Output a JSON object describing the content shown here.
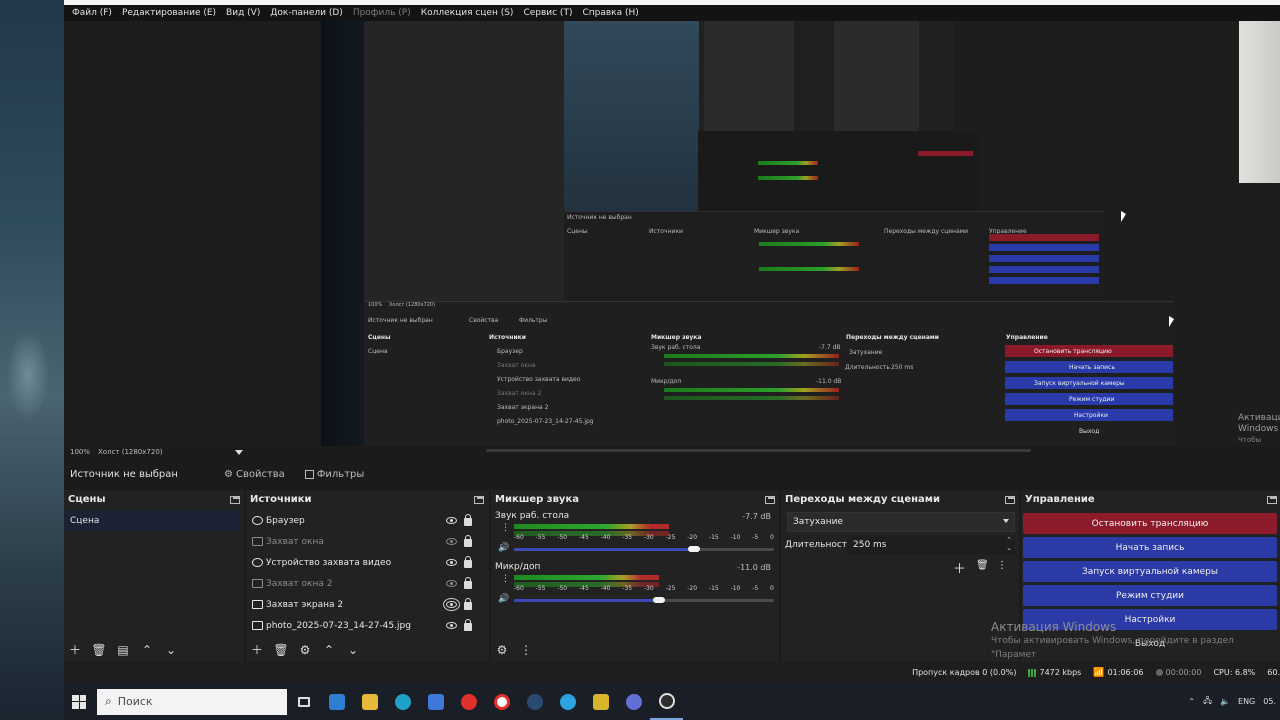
{
  "menu": {
    "items": [
      {
        "label": "Файл (F)"
      },
      {
        "label": "Редактирование (E)"
      },
      {
        "label": "Вид (V)"
      },
      {
        "label": "Док-панели (D)"
      },
      {
        "label": "Профиль (P)"
      },
      {
        "label": "Коллекция сцен (S)"
      },
      {
        "label": "Сервис (T)"
      },
      {
        "label": "Справка (H)"
      }
    ]
  },
  "preview": {
    "zoom": "100%",
    "canvas_label": "Холст (1280x720)",
    "nested": {
      "source_not_selected": "Источник не выбран",
      "properties": "Свойства",
      "filters": "Фильтры",
      "scenes": "Сцены",
      "scene": "Сцена",
      "sources": "Источники",
      "src1": "Браузер",
      "src2": "Захват окна",
      "src3": "Устройство захвата видео",
      "src4": "Захват окна 2",
      "src5": "Захват экрана 2",
      "src6": "photo_2025-07-23_14-27-45.jpg",
      "mixer": "Микшер звука",
      "desk": "Звук раб. стола",
      "desk_db": "-7.7 dB",
      "mic": "Микр/доп",
      "mic_db": "-11.0 dB",
      "transitions": "Переходы между сценами",
      "fade": "Затухание",
      "duration": "Длительность",
      "duration_val": "250 ms",
      "controls": "Управление",
      "stop_stream": "Остановить трансляцию",
      "start_rec": "Начать запись",
      "virtual_cam": "Запуск виртуальной камеры",
      "studio": "Режим студии",
      "settings": "Настройки",
      "exit": "Выход",
      "activation_title": "Активация Windows",
      "activation_sub": "Чтобы активировать Windows, перейдите в раздел \"Параметры\"",
      "canvas_label": "Холст (1280x720)",
      "zoom": "100%"
    }
  },
  "source_bar": {
    "no_source": "Источник не выбран",
    "properties": "Свойства",
    "filters": "Фильтры"
  },
  "scenes": {
    "title": "Сцены",
    "items": [
      {
        "label": "Сцена"
      }
    ]
  },
  "sources": {
    "title": "Источники",
    "items": [
      {
        "label": "Браузер"
      },
      {
        "label": "Захват окна"
      },
      {
        "label": "Устройство захвата видео"
      },
      {
        "label": "Захват окна 2"
      },
      {
        "label": "Захват экрана 2"
      },
      {
        "label": "photo_2025-07-23_14-27-45.jpg"
      }
    ]
  },
  "mixer": {
    "title": "Микшер звука",
    "channels": [
      {
        "name": "Звук раб. стола",
        "db": "-7.7 dB",
        "level": 0.62,
        "volume": 0.72
      },
      {
        "name": "Микр/доп",
        "db": "-11.0 dB",
        "level": 0.58,
        "volume": 0.58
      }
    ],
    "scale": [
      "-60",
      "-55",
      "-50",
      "-45",
      "-40",
      "-35",
      "-30",
      "-25",
      "-20",
      "-15",
      "-10",
      "-5",
      "0"
    ]
  },
  "transitions": {
    "title": "Переходы между сценами",
    "selected": "Затухание",
    "duration_label": "Длительность",
    "duration_value": "250 ms"
  },
  "controls": {
    "title": "Управление",
    "stop_stream": "Остановить трансляцию",
    "start_recording": "Начать запись",
    "virtual_camera": "Запуск виртуальной камеры",
    "studio_mode": "Режим студии",
    "settings": "Настройки",
    "exit": "Выход"
  },
  "activation": {
    "title": "Активация Windows",
    "subtitle": "Чтобы активировать Windows, перейдите в раздел \"Парамет"
  },
  "statusbar": {
    "dropped_frames": "Пропуск кадров 0 (0.0%)",
    "bitrate": "7472 kbps",
    "stream_time": "01:06:06",
    "rec_time": "00:00:00",
    "cpu": "CPU: 6.8%",
    "fps": "60."
  },
  "taskbar": {
    "search_placeholder": "Поиск",
    "lang": "ENG",
    "date_fragment": "05."
  },
  "colors": {
    "stop_stream_bg": "#8e1b2b",
    "control_button_bg": "#2b3aa6",
    "panel_bg": "#222222",
    "window_bg": "#1b1b1b"
  }
}
